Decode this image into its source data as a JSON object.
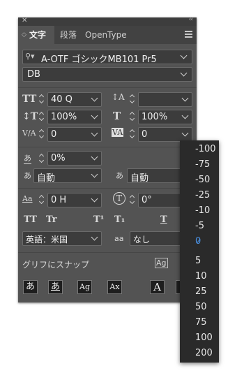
{
  "tabs": [
    "文字",
    "段落",
    "OpenType"
  ],
  "font": {
    "family": "A-OTF ゴシックMB101 Pr5",
    "style": "DB"
  },
  "icons": {
    "size": "TT",
    "leading": "↕T",
    "kerning": "V/A",
    "tracking": "VA",
    "vscale": "T",
    "hscale": "T",
    "tsume": "あ",
    "aki_left": "あ",
    "aki_right": "あ",
    "baseline": "Aa",
    "rotate": "T",
    "tt_row": [
      "TT",
      "Tr",
      "T¹",
      "T₁",
      "T"
    ],
    "glyph": "あ",
    "snap": [
      "あ",
      "あ",
      "Ag",
      "Ax",
      "A"
    ]
  },
  "fields": {
    "size": "40 Q",
    "leading_label": "",
    "vscale": "100%",
    "hscale": "100%",
    "kerning": "0",
    "tracking": "0",
    "tsume": "0%",
    "aki_left": "自動",
    "aki_right": "自動",
    "baseline": "0 H",
    "rotate": "0°",
    "language": "英語：米国",
    "aa_label": "aa",
    "antialias": "なし"
  },
  "snap_label": "グリフにスナップ",
  "dropdown": {
    "items": [
      "-100",
      "-75",
      "-50",
      "-25",
      "-10",
      "-5",
      "0",
      "5",
      "10",
      "25",
      "50",
      "75",
      "100",
      "200"
    ],
    "selected": "0"
  }
}
